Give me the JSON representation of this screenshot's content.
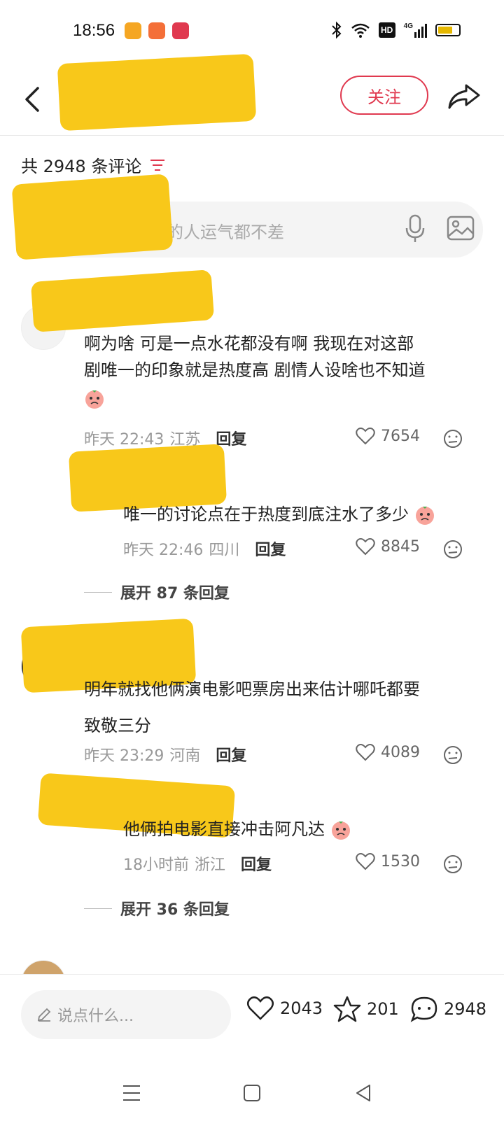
{
  "status_bar": {
    "time": "18:56",
    "badge_colors": [
      "#f5a623",
      "#f46f38",
      "#e0394f"
    ],
    "indicators": [
      "bluetooth-icon",
      "wifi-icon",
      "hd-icon",
      "4g-signal-icon",
      "battery-icon"
    ],
    "hd_label": "HD",
    "network_label": "4G"
  },
  "header": {
    "follow_label": "关注"
  },
  "comments_section": {
    "count_label": "共 2948 条评论",
    "input_placeholder": "论的人运气都不差"
  },
  "comments": [
    {
      "text_line1": "啊为啥 可是一点水花都没有啊 我现在对这部",
      "text_line2": "剧唯一的印象就是热度高 剧情人设啥也不知道",
      "time": "昨天 22:43",
      "location": "江苏",
      "reply_label": "回复",
      "likes": "7654"
    },
    {
      "text": "唯一的讨论点在于热度到底注水了多少",
      "time": "昨天 22:46",
      "location": "四川",
      "reply_label": "回复",
      "likes": "8845"
    },
    {
      "text_line1": "明年就找他俩演电影吧票房出来估计哪吒都要",
      "text_line2": "致敬三分",
      "time": "昨天 23:29",
      "location": "河南",
      "reply_label": "回复",
      "likes": "4089"
    },
    {
      "text": "他俩拍电影直接冲击阿凡达",
      "time": "18小时前",
      "location": "浙江",
      "reply_label": "回复",
      "likes": "1530"
    }
  ],
  "expand_labels": [
    "展开 87 条回复",
    "展开 36 条回复"
  ],
  "bottom_bar": {
    "input_placeholder": "说点什么...",
    "likes": "2043",
    "favorites": "201",
    "comments": "2948"
  },
  "colors": {
    "accent": "#e0394f",
    "redaction": "#f8c81a"
  }
}
